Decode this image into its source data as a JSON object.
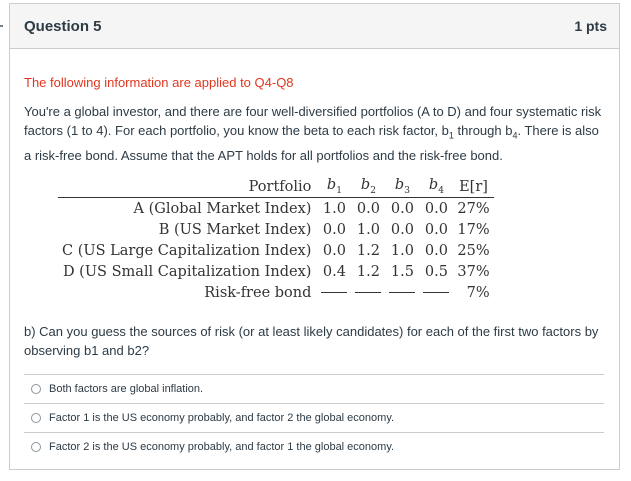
{
  "question": {
    "title": "Question 5",
    "points": "1 pts"
  },
  "intro": {
    "applies": "The following information are applied to Q4-Q8",
    "text_part1": "You're a global investor, and there are four well-diversified portfolios (A to D) and four systematic risk factors (1 to 4). For each portfolio, you know the beta to each risk factor, b",
    "sub1": "1",
    "text_part2": " through b",
    "sub2": "4",
    "text_part3": ". There is also a risk-free bond. Assume that the APT holds for all portfolios and the risk-free bond.",
    "accent_color": "#e0371f"
  },
  "table": {
    "headers": [
      "Portfolio",
      "b1",
      "b2",
      "b3",
      "b4",
      "E[r]"
    ],
    "rows": [
      [
        "A (Global Market Index)",
        "1.0",
        "0.0",
        "0.0",
        "0.0",
        "27%"
      ],
      [
        "B (US Market Index)",
        "0.0",
        "1.0",
        "0.0",
        "0.0",
        "17%"
      ],
      [
        "C (US Large Capitalization Index)",
        "0.0",
        "1.2",
        "1.0",
        "0.0",
        "25%"
      ],
      [
        "D (US Small Capitalization Index)",
        "0.4",
        "1.2",
        "1.5",
        "0.5",
        "37%"
      ]
    ],
    "riskfree": {
      "name": "Risk-free bond",
      "er": "7%"
    }
  },
  "sub_question": "b) Can you guess the sources of risk (or at least likely candidates) for each of the first two factors by observing b1 and b2?",
  "answers": [
    "Both factors are global inflation.",
    "Factor 1 is the US economy probably, and factor 2 the global economy.",
    "Factor 2 is the US economy probably, and factor 1 the global economy."
  ]
}
